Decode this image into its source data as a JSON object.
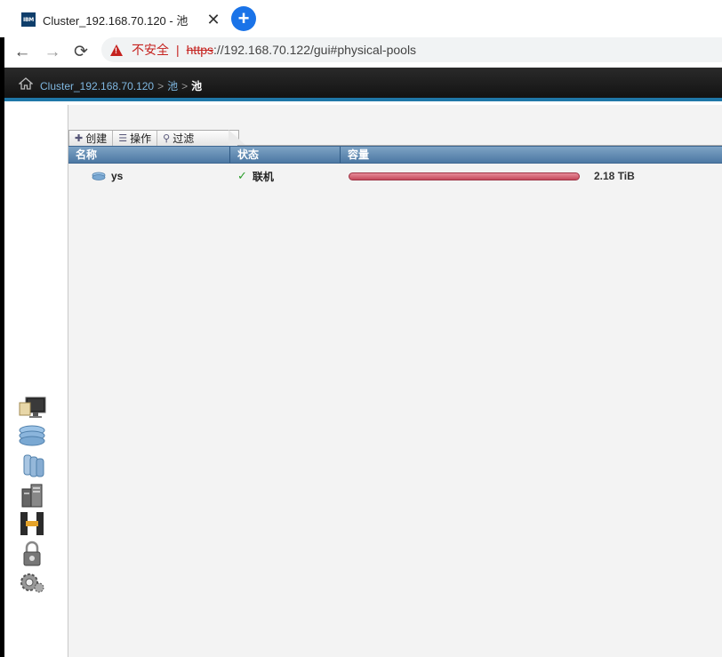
{
  "browser": {
    "tab": {
      "favicon_text": "IBM",
      "title": "Cluster_192.168.70.120 - 池",
      "close": "✕"
    },
    "new_tab": "+",
    "nav": {
      "back": "←",
      "forward": "→",
      "reload": "⟳"
    },
    "address": {
      "security_label": "不安全",
      "separator": "|",
      "scheme": "https",
      "rest": "://192.168.70.122/gui#physical-pools"
    }
  },
  "breadcrumb": {
    "cluster": "Cluster_192.168.70.120",
    "sep1": ">",
    "section": "池",
    "sep2": ">",
    "current": "池"
  },
  "toolbar": {
    "create": "创建",
    "actions": "操作",
    "filter": "过滤"
  },
  "grid": {
    "columns": [
      "名称",
      "状态",
      "容量"
    ],
    "rows": [
      {
        "name": "ys",
        "status": "联机",
        "capacity": "2.18 TiB",
        "used_fraction": 1.0
      }
    ]
  },
  "sidebar_icons": [
    "monitoring-icon",
    "pools-icon",
    "volumes-icon",
    "hosts-icon",
    "copy-services-icon",
    "access-icon",
    "settings-icon"
  ],
  "colors": {
    "accent": "#1f77a8",
    "header_blue": "#4c78a3",
    "capacity_bar": "#c54a5c",
    "online_check": "#2a9d2a",
    "insecure_red": "#c5221f"
  }
}
